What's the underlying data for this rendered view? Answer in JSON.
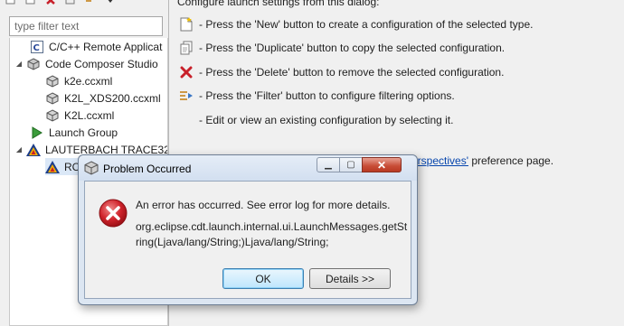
{
  "filter": {
    "placeholder": "type filter text"
  },
  "tree": [
    {
      "label": "C/C++ Remote Applicat",
      "icon": "c-app-icon"
    },
    {
      "label": "Code Composer Studio",
      "icon": "ccs-cube-icon"
    },
    {
      "label": "k2e.ccxml",
      "icon": "ccs-cube-icon"
    },
    {
      "label": "K2L_XDS200.ccxml",
      "icon": "ccs-cube-icon"
    },
    {
      "label": "K2L.ccxml",
      "icon": "ccs-cube-icon"
    },
    {
      "label": "Launch Group",
      "icon": "launch-group-icon"
    },
    {
      "label": "LAUTERBACH TRACE32",
      "icon": "trace32-icon"
    },
    {
      "label": "RC",
      "icon": "trace32-icon"
    }
  ],
  "right": {
    "heading": "Configure launch settings from this dialog:",
    "instructions": [
      {
        "icon": "new-config-icon",
        "text": "- Press the 'New' button to create a configuration of the selected type."
      },
      {
        "icon": "duplicate-icon",
        "text": "- Press the 'Duplicate' button to copy the selected configuration."
      },
      {
        "icon": "delete-x-icon",
        "text": "- Press the 'Delete' button to remove the selected configuration."
      },
      {
        "icon": "filter-icon",
        "text": "- Press the 'Filter' button to configure filtering options."
      },
      {
        "icon": "",
        "text": "- Edit or view an existing configuration by selecting it."
      }
    ],
    "pref_link": "erspectives'",
    "pref_suffix": " preference page."
  },
  "dialog": {
    "title": "Problem Occurred",
    "message": "An error has occurred. See error log for more details.",
    "detail": "org.eclipse.cdt.launch.internal.ui.LaunchMessages.getString(Ljava/lang/String;)Ljava/lang/String;",
    "ok_label": "OK",
    "details_label": "Details >>",
    "close_glyph": "✕",
    "minimize_glyph": "▁",
    "maximize_glyph": "▢"
  },
  "colors": {
    "error_red": "#c8202a",
    "link": "#0645ad",
    "dialog_frame": "#dce6f2"
  }
}
